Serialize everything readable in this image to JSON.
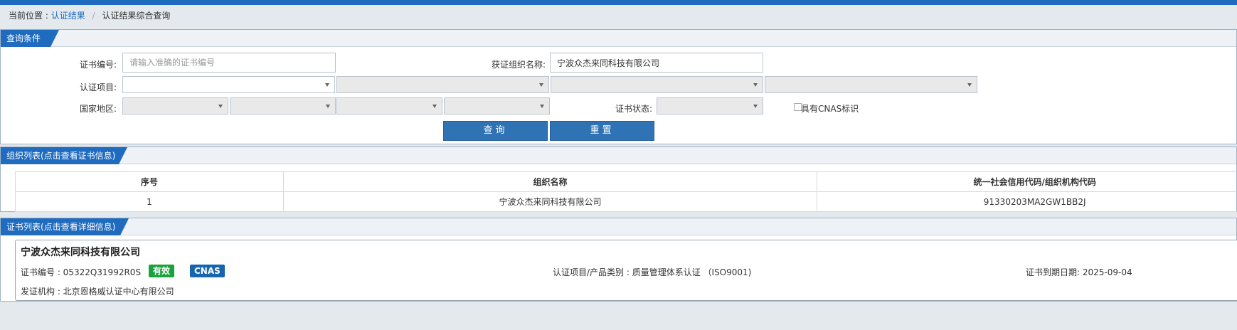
{
  "breadcrumb": {
    "prefix": "当前位置 :",
    "item1": "认证结果",
    "sep": "/",
    "item2": "认证结果综合查询"
  },
  "query_panel": {
    "title": "查询条件",
    "cert_no_label": "证书编号:",
    "cert_no_placeholder": "请输入准确的证书编号",
    "org_name_label": "获证组织名称:",
    "org_name_value": "宁波众杰来同科技有限公司",
    "cert_item_label": "认证项目:",
    "region_label": "国家地区:",
    "cert_status_label": "证书状态:",
    "cnas_checkbox_label": "具有CNAS标识",
    "search_button": "查询",
    "reset_button": "重置"
  },
  "org_panel": {
    "title": "组织列表(点击查看证书信息)",
    "columns": [
      "序号",
      "组织名称",
      "统一社会信用代码/组织机构代码"
    ],
    "rows": [
      [
        "1",
        "宁波众杰来同科技有限公司",
        "91330203MA2GW1BB2J"
      ]
    ]
  },
  "cert_panel": {
    "title": "证书列表(点击查看详细信息)",
    "company": "宁波众杰来同科技有限公司",
    "cert_no": "证书编号 : 05322Q31992R0S",
    "status_badge": "有效",
    "cnas_badge": "CNAS",
    "item": "认证项目/产品类别 : 质量管理体系认证 （ISO9001)",
    "expiry": "证书到期日期: 2025-09-04",
    "issuer": "发证机构 : 北京恩格威认证中心有限公司"
  },
  "colors": {
    "accent": "#1e6bbf",
    "button": "#2f73b5",
    "valid_green": "#1aa23c",
    "cnas_blue": "#1665b0"
  },
  "icons": [
    "chevron-down-icon"
  ]
}
